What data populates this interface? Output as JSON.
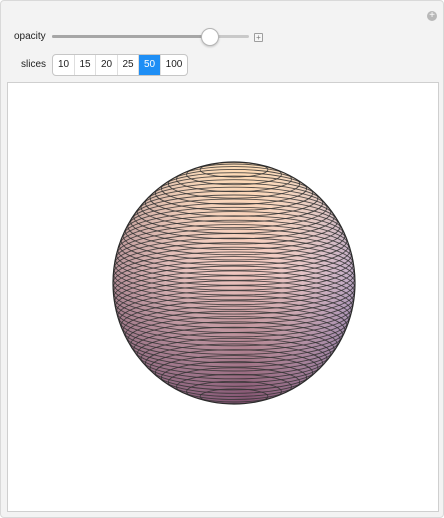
{
  "controls": {
    "opacity": {
      "label": "opacity",
      "value": 0.8
    },
    "slices": {
      "label": "slices",
      "options": [
        "10",
        "15",
        "20",
        "25",
        "50",
        "100"
      ],
      "selected": "50"
    }
  },
  "plot": {
    "shape": "sphere",
    "slice_count": 50,
    "colors": {
      "top": "#ffdcb4",
      "middle": "#f2c8c0",
      "bottom_left": "#80506f",
      "bottom_right": "#9aa6e4",
      "edge": "#333333"
    }
  },
  "icons": {
    "panel_options": "plus-circle-icon",
    "slider_expand": "plus-square-icon"
  }
}
